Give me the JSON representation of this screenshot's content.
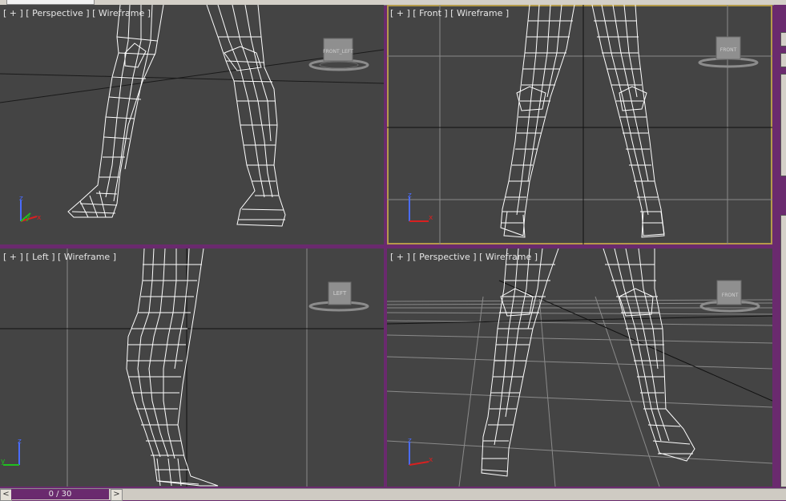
{
  "viewports": {
    "top_left": {
      "label": "[ + ] [ Perspective ] [ Wireframe ]",
      "viewcube": "FRONT_LEFT"
    },
    "top_right": {
      "label": "[ + ] [ Front ] [ Wireframe ]",
      "viewcube": "FRONT"
    },
    "bottom_left": {
      "label": "[ + ] [ Left ] [ Wireframe ]",
      "viewcube": "LEFT"
    },
    "bottom_right": {
      "label": "[ + ] [ Perspective ] [ Wireframe ]",
      "viewcube": "FRONT"
    }
  },
  "axis_labels": {
    "x": "x",
    "y": "y",
    "z": "z"
  },
  "timeline": {
    "frame_display": "0 / 30",
    "prev": "<",
    "next": ">"
  },
  "colors": {
    "viewport_bg": "#444444",
    "wire": "#ffffff",
    "grid": "#8a8a8a",
    "frame": "#6a2a6e",
    "active_border": "#b49a4a",
    "axis_x": "#d82020",
    "axis_y": "#20c020",
    "axis_z": "#4a6cff"
  },
  "icons": [
    "viewcube-icon",
    "axis-tripod-icon",
    "wireframe-leg-mesh"
  ]
}
